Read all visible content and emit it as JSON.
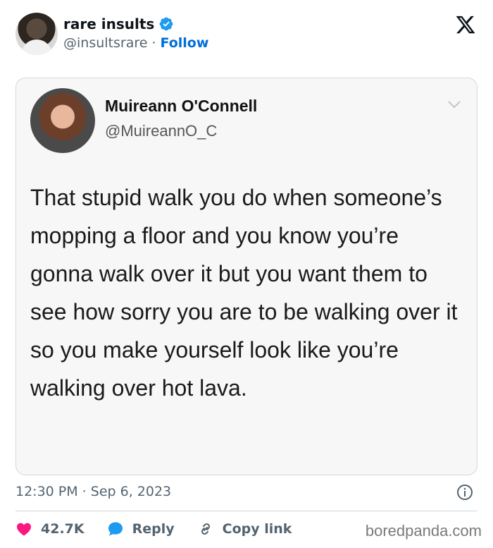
{
  "author": {
    "display_name": "rare insults",
    "handle": "@insultsrare",
    "separator": "·",
    "follow_label": "Follow",
    "verified_color": "#1d9bf0"
  },
  "quoted_tweet": {
    "display_name": "Muireann O'Connell",
    "handle": "@MuireannO_C",
    "text": "That stupid walk you do when someone’s mopping a floor and you know you’re gonna walk over it but you want them to see how sorry you are to be walking over it so you make yourself look like you’re walking over hot lava."
  },
  "meta": {
    "timestamp": "12:30 PM · Sep 6, 2023"
  },
  "actions": {
    "like_count": "42.7K",
    "reply_label": "Reply",
    "copy_link_label": "Copy link",
    "like_color": "#f91880",
    "reply_color": "#1d9bf0"
  },
  "watermark": "boredpanda.com"
}
